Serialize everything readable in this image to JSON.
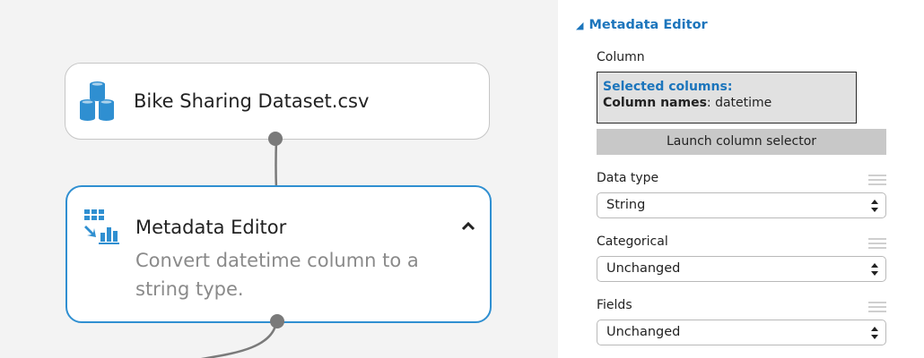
{
  "canvas": {
    "modules": [
      {
        "title": "Bike Sharing Dataset.csv",
        "icon": "database-stack-icon"
      },
      {
        "title": "Metadata Editor",
        "description": "Convert datetime column to a string type.",
        "icon": "metadata-editor-icon",
        "selected": true,
        "collapse_icon": "chevron-up-icon"
      }
    ]
  },
  "panel": {
    "section_title": "Metadata Editor",
    "column": {
      "label": "Column",
      "selected_title": "Selected columns:",
      "names_label": "Column names",
      "names_value": ": datetime",
      "launch_label": "Launch column selector"
    },
    "data_type": {
      "label": "Data type",
      "value": "String"
    },
    "categorical": {
      "label": "Categorical",
      "value": "Unchanged"
    },
    "fields": {
      "label": "Fields",
      "value": "Unchanged"
    }
  },
  "colors": {
    "accent": "#1c75bc",
    "selected_border": "#2f8fd1",
    "icon_blue": "#2f8fd1"
  }
}
